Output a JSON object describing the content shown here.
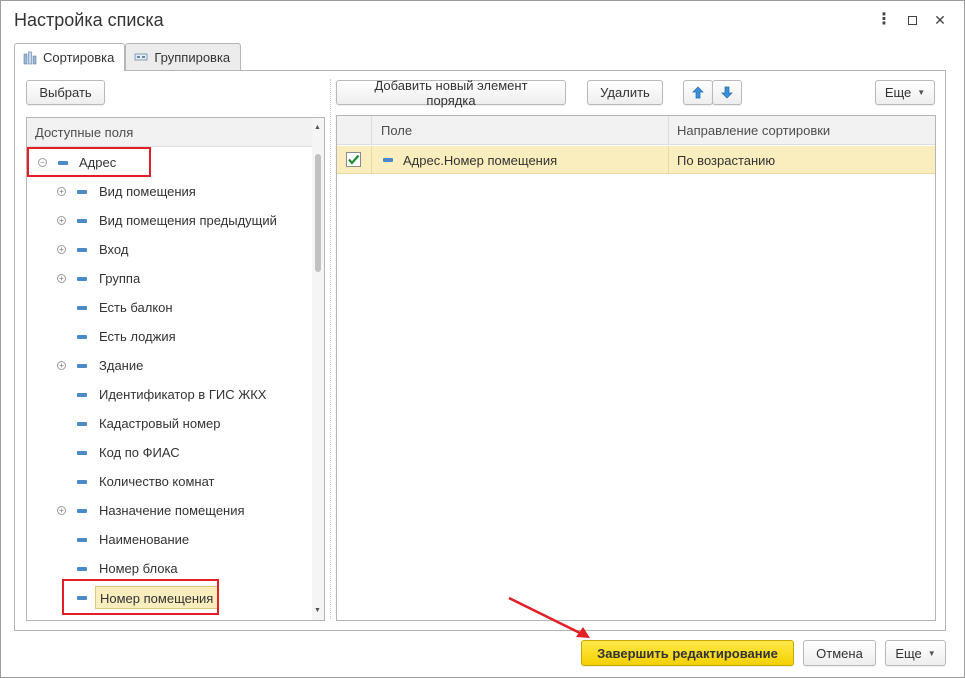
{
  "window": {
    "title": "Настройка списка",
    "controls": [
      "more-vert-icon",
      "maximize-icon",
      "close-icon"
    ]
  },
  "tabs": [
    {
      "label": "Сортировка",
      "icon": "sort-icon",
      "active": true
    },
    {
      "label": "Группировка",
      "icon": "group-icon",
      "active": false
    }
  ],
  "left": {
    "select_button": "Выбрать",
    "header": "Доступные поля",
    "items": [
      {
        "label": "Адрес",
        "expand": "collapse",
        "level": 0
      },
      {
        "label": "Вид помещения",
        "expand": "expand",
        "level": 1
      },
      {
        "label": "Вид помещения предыдущий",
        "expand": "expand",
        "level": 1
      },
      {
        "label": "Вход",
        "expand": "expand",
        "level": 1
      },
      {
        "label": "Группа",
        "expand": "expand",
        "level": 1
      },
      {
        "label": "Есть балкон",
        "expand": "",
        "level": 1
      },
      {
        "label": "Есть лоджия",
        "expand": "",
        "level": 1
      },
      {
        "label": "Здание",
        "expand": "expand",
        "level": 1
      },
      {
        "label": "Идентификатор в ГИС ЖКХ",
        "expand": "",
        "level": 1
      },
      {
        "label": "Кадастровый номер",
        "expand": "",
        "level": 1
      },
      {
        "label": "Код по ФИАС",
        "expand": "",
        "level": 1
      },
      {
        "label": "Количество комнат",
        "expand": "",
        "level": 1
      },
      {
        "label": "Назначение помещения",
        "expand": "expand",
        "level": 1
      },
      {
        "label": "Наименование",
        "expand": "",
        "level": 1
      },
      {
        "label": "Номер блока",
        "expand": "",
        "level": 1
      },
      {
        "label": "Номер помещения",
        "expand": "",
        "level": 1,
        "selected": true
      }
    ]
  },
  "right": {
    "add_button": "Добавить новый элемент порядка",
    "delete_button": "Удалить",
    "more_button": "Еще",
    "columns": [
      "Поле",
      "Направление сортировки"
    ],
    "rows": [
      {
        "checked": true,
        "field": "Адрес.Номер помещения",
        "direction": "По возрастанию"
      }
    ]
  },
  "footer": {
    "finish_button": "Завершить редактирование",
    "cancel_button": "Отмена",
    "more_button": "Еще"
  },
  "colors": {
    "accent_yellow": "#f5d100",
    "selected_row": "#fbeebe",
    "highlight_red": "#e31e24",
    "field_icon": "#4a8bc8"
  }
}
